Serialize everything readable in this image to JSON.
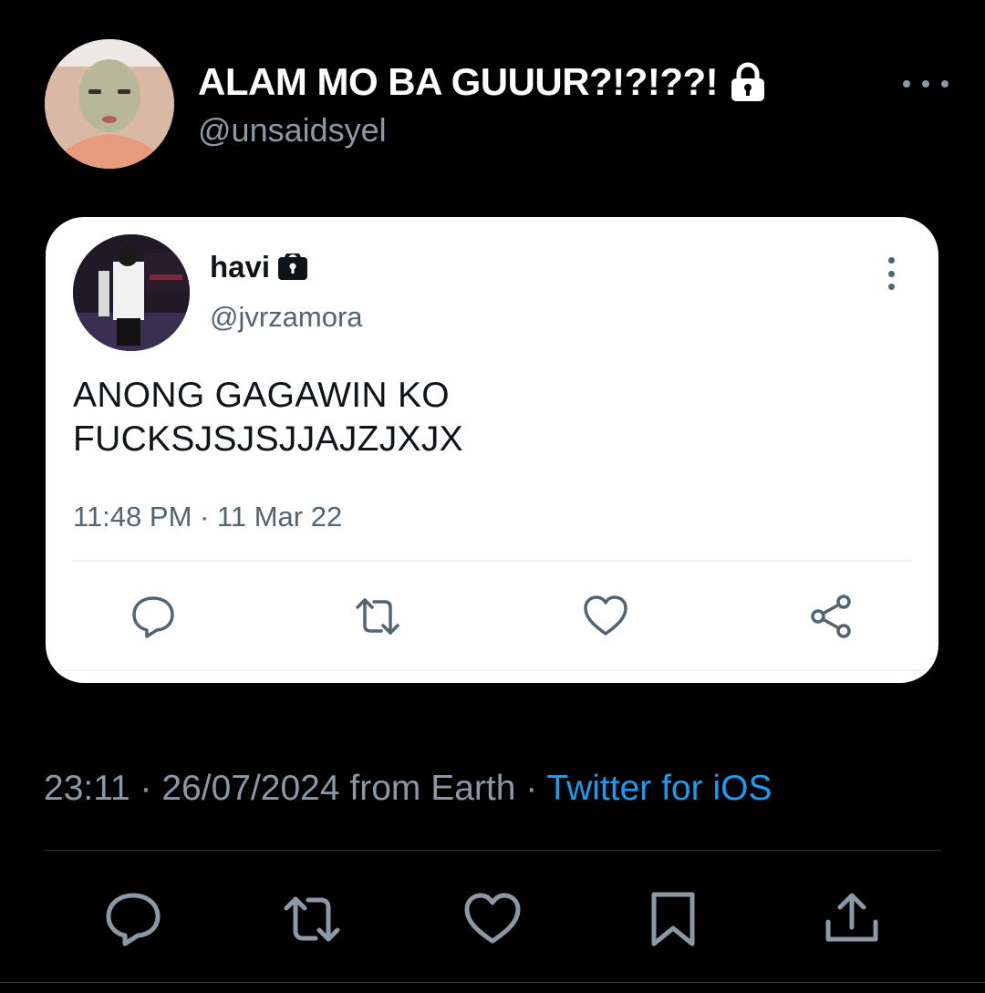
{
  "tweet": {
    "author_name": "ALAM MO BA GUUUR?!?!??!",
    "author_handle": "@unsaidsyel",
    "author_locked": true,
    "timestamp": "23:11 · 26/07/2024 from Earth",
    "separator": " · ",
    "source": "Twitter for iOS"
  },
  "quoted": {
    "author_name": "havi",
    "author_handle": "@jvrzamora",
    "author_locked": true,
    "text_lines": [
      "ANONG GAGAWIN KO",
      "FUCKSJSJSJJAJZJXJX"
    ],
    "timestamp": "11:48 PM · 11 Mar 22"
  },
  "icons": {
    "tweet_actions": [
      "reply-icon",
      "retweet-icon",
      "like-icon",
      "bookmark-icon",
      "share-icon"
    ],
    "card_actions": [
      "reply-icon",
      "retweet-icon",
      "like-icon",
      "share-icon"
    ]
  },
  "colors": {
    "background": "#000000",
    "text_primary": "#ffffff",
    "text_secondary": "#8b98a5",
    "link": "#1d9bf0",
    "card_background": "#ffffff",
    "card_text": "#0f1419",
    "card_secondary": "#536471"
  }
}
